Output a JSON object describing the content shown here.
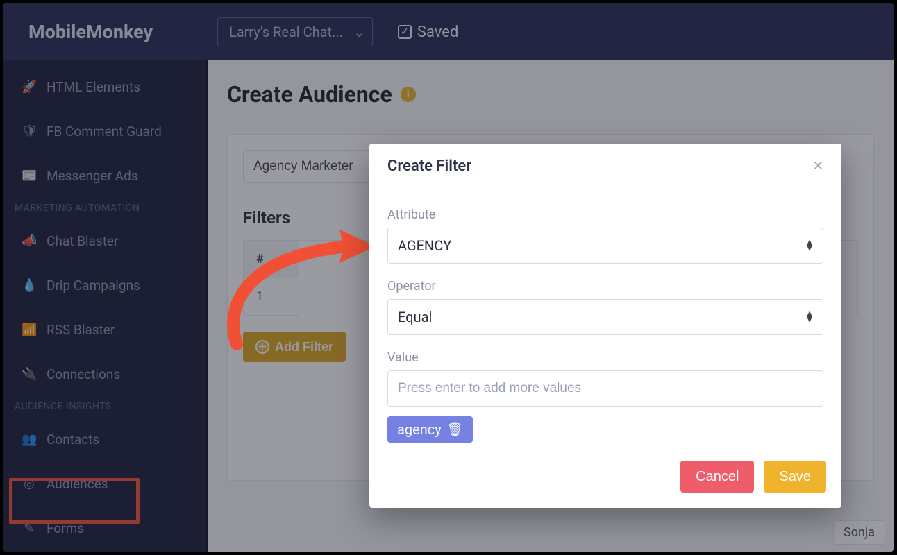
{
  "brand": "MobileMonkey",
  "header": {
    "workspace_label": "Larry's Real Chat...",
    "saved_label": "Saved"
  },
  "sidebar": {
    "items": [
      {
        "icon": "rocket-icon",
        "label": "HTML Elements"
      },
      {
        "icon": "shield-icon",
        "label": "FB Comment Guard"
      },
      {
        "icon": "newspaper-icon",
        "label": "Messenger Ads"
      }
    ],
    "section_marketing": "MARKETING AUTOMATION",
    "marketing": [
      {
        "icon": "megaphone-icon",
        "label": "Chat Blaster"
      },
      {
        "icon": "dropper-icon",
        "label": "Drip Campaigns"
      },
      {
        "icon": "rss-icon",
        "label": "RSS Blaster"
      },
      {
        "icon": "plug-icon",
        "label": "Connections"
      }
    ],
    "section_insights": "AUDIENCE INSIGHTS",
    "insights": [
      {
        "icon": "users-icon",
        "label": "Contacts"
      },
      {
        "icon": "target-icon",
        "label": "Audiences",
        "active": true
      },
      {
        "icon": "edit-icon",
        "label": "Forms"
      }
    ]
  },
  "page": {
    "title": "Create Audience",
    "audience_name_value": "Agency Marketer",
    "filters_title": "Filters",
    "filters_header_num": "#",
    "filters_rows": [
      {
        "num": "1"
      }
    ],
    "add_filter_label": "Add Filter"
  },
  "modal": {
    "title": "Create Filter",
    "attribute_label": "Attribute",
    "attribute_value": "AGENCY",
    "operator_label": "Operator",
    "operator_value": "Equal",
    "value_label": "Value",
    "value_placeholder": "Press enter to add more values",
    "chips": [
      "agency"
    ],
    "cancel_label": "Cancel",
    "save_label": "Save"
  },
  "sidepanel": {
    "row_name": "Sonja"
  },
  "colors": {
    "accent_yellow": "#efb32c",
    "accent_red": "#ef5d6b",
    "chip_purple": "#7681e4",
    "annotation_red": "#f25035"
  }
}
